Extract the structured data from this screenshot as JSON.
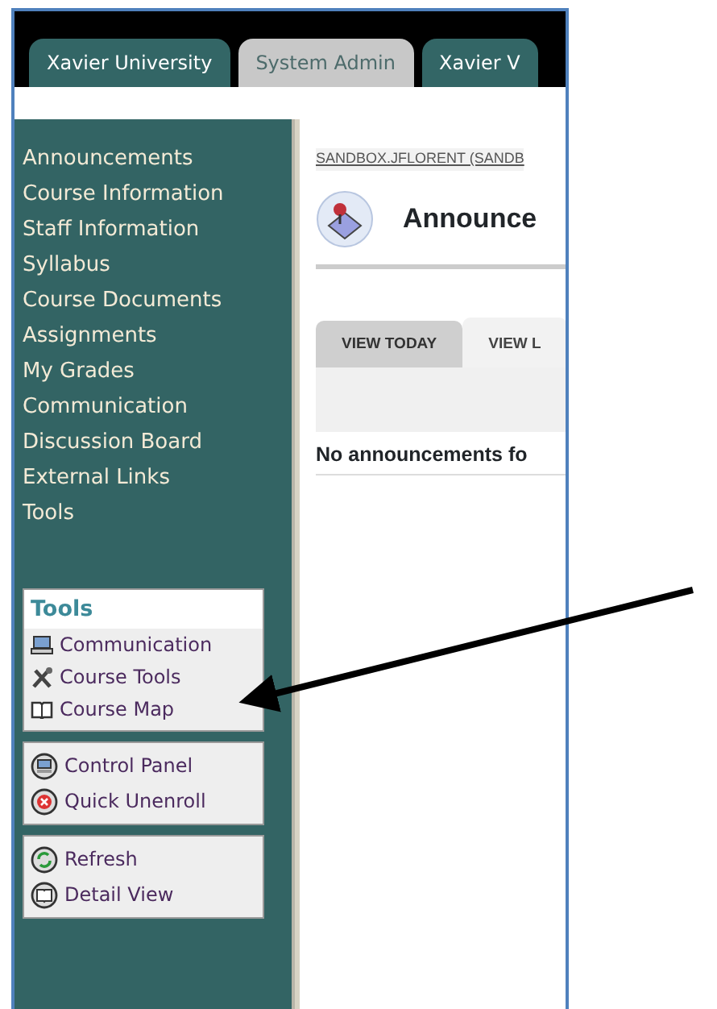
{
  "course_tabs": [
    {
      "label": "Xavier University",
      "selected": false
    },
    {
      "label": "System Admin",
      "selected": true
    },
    {
      "label": "Xavier V",
      "selected": false
    }
  ],
  "sidebar": {
    "menu": [
      "Announcements",
      "Course Information",
      "Staff Information",
      "Syllabus",
      "Course Documents",
      "Assignments",
      "My Grades",
      "Communication",
      "Discussion Board",
      "External Links",
      "Tools"
    ],
    "panels": [
      {
        "title": "Tools",
        "items": [
          {
            "label": "Communication",
            "kind": "monitor"
          },
          {
            "label": "Course Tools",
            "kind": "tools"
          },
          {
            "label": "Course Map",
            "kind": "map"
          }
        ]
      },
      {
        "items": [
          {
            "label": "Control Panel",
            "kind": "control"
          },
          {
            "label": "Quick Unenroll",
            "kind": "unenroll"
          }
        ]
      },
      {
        "items": [
          {
            "label": "Refresh",
            "kind": "refresh"
          },
          {
            "label": "Detail View",
            "kind": "detail"
          }
        ]
      }
    ]
  },
  "content": {
    "breadcrumb": "SANDBOX.JFLORENT (SANDB",
    "title": "Announce",
    "tabs": [
      {
        "label": "VIEW TODAY",
        "selected": false
      },
      {
        "label": "VIEW L",
        "selected": true
      }
    ],
    "message": "No announcements fo"
  },
  "annotation": {
    "kind": "arrow"
  }
}
